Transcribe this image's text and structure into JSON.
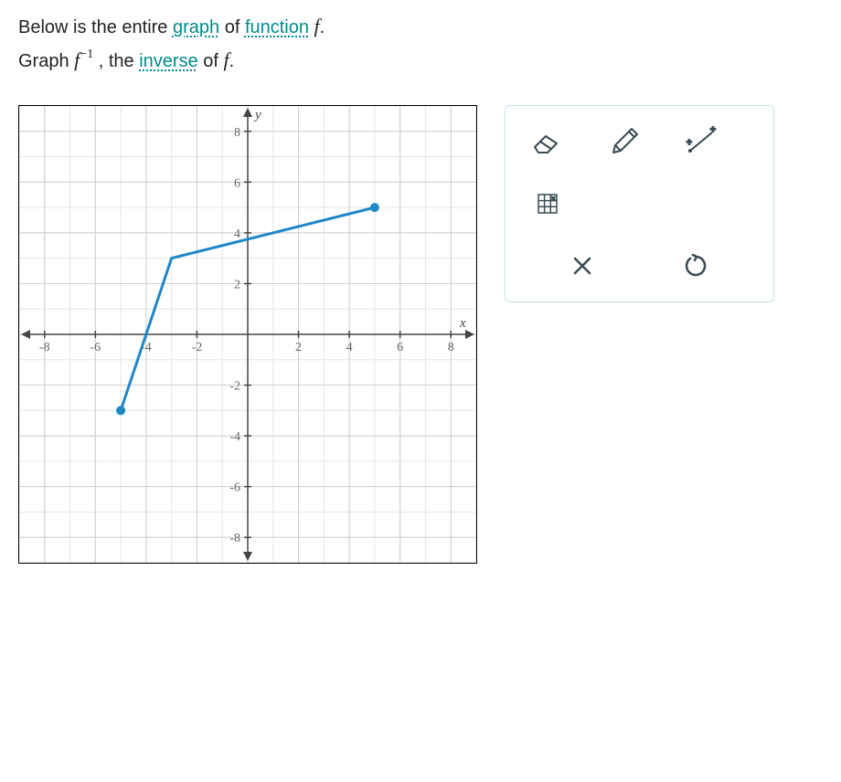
{
  "instructions": {
    "line1_pre": "Below is the entire ",
    "line1_link1": "graph",
    "line1_mid": " of ",
    "line1_link2": "function",
    "line1_fn": " f",
    "line1_post": ".",
    "line2_pre": "Graph ",
    "line2_fn": "f",
    "line2_sup": "−1",
    "line2_comma": " , the ",
    "line2_link": "inverse",
    "line2_post": " of ",
    "line2_fn2": "f",
    "line2_end": "."
  },
  "chart_data": {
    "type": "line",
    "xlim": [
      -9,
      9
    ],
    "ylim": [
      -9,
      9
    ],
    "xticks": [
      -8,
      -6,
      -4,
      -2,
      2,
      4,
      6,
      8
    ],
    "yticks": [
      -8,
      -6,
      -4,
      -2,
      2,
      4,
      6,
      8
    ],
    "xlabel": "x",
    "ylabel": "y",
    "series": [
      {
        "name": "f",
        "points": [
          {
            "x": -5,
            "y": -3
          },
          {
            "x": -3,
            "y": 3
          },
          {
            "x": 5,
            "y": 5
          }
        ]
      }
    ]
  },
  "tools": {
    "eraser": "eraser-tool",
    "pencil": "pencil-tool",
    "line": "line-tool",
    "grid": "grid-tool",
    "clear": "clear-tool",
    "undo": "undo-tool"
  }
}
